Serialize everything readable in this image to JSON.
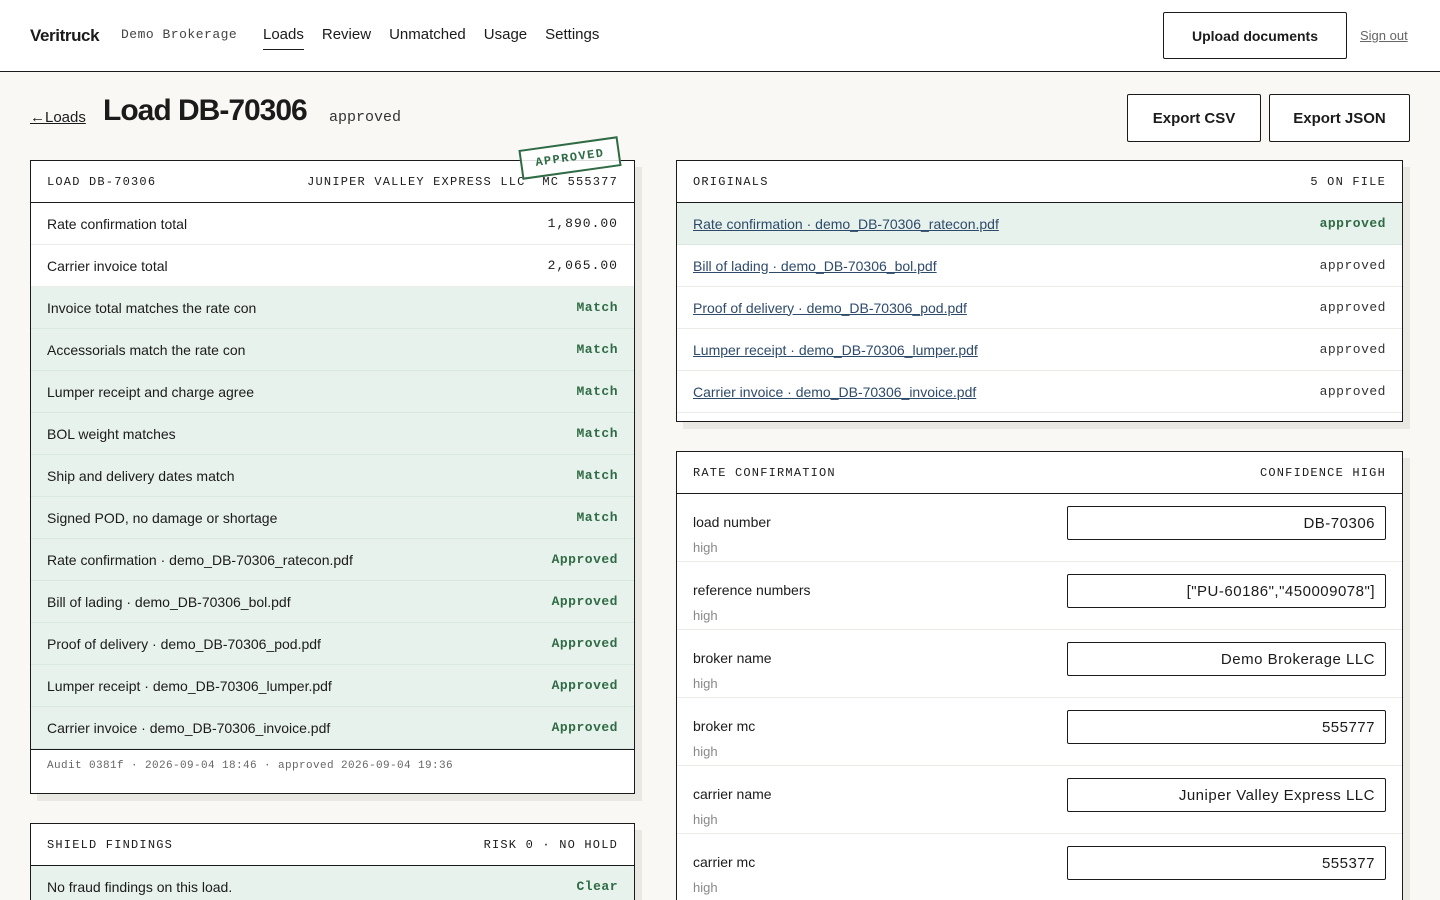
{
  "topbar": {
    "brand": "Veritruck",
    "org": "Demo Brokerage",
    "nav": [
      "Loads",
      "Review",
      "Unmatched",
      "Usage",
      "Settings"
    ],
    "active_nav": "Loads",
    "upload_label": "Upload documents",
    "signout_label": "Sign out"
  },
  "header": {
    "back_label": "←Loads",
    "title": "Load DB-70306",
    "status": "approved",
    "export_csv": "Export CSV",
    "export_json": "Export JSON"
  },
  "load_card": {
    "head_left": "LOAD DB-70306",
    "head_carrier": "JUNIPER VALLEY EXPRESS LLC",
    "head_mc": "MC 555377",
    "stamp": "APPROVED",
    "totals": [
      {
        "label": "Rate confirmation total",
        "value": "1,890.00"
      },
      {
        "label": "Carrier invoice total",
        "value": "2,065.00"
      }
    ],
    "checks": [
      {
        "label": "Invoice total matches the rate con",
        "value": "Match"
      },
      {
        "label": "Accessorials match the rate con",
        "value": "Match"
      },
      {
        "label": "Lumper receipt and charge agree",
        "value": "Match"
      },
      {
        "label": "BOL weight matches",
        "value": "Match"
      },
      {
        "label": "Ship and delivery dates match",
        "value": "Match"
      },
      {
        "label": "Signed POD, no damage or shortage",
        "value": "Match"
      },
      {
        "label": "Rate confirmation · demo_DB-70306_ratecon.pdf",
        "value": "Approved"
      },
      {
        "label": "Bill of lading · demo_DB-70306_bol.pdf",
        "value": "Approved"
      },
      {
        "label": "Proof of delivery · demo_DB-70306_pod.pdf",
        "value": "Approved"
      },
      {
        "label": "Lumper receipt · demo_DB-70306_lumper.pdf",
        "value": "Approved"
      },
      {
        "label": "Carrier invoice · demo_DB-70306_invoice.pdf",
        "value": "Approved"
      }
    ],
    "audit": "Audit 0381f · 2026-09-04 18:46 · approved 2026-09-04 19:36"
  },
  "shield_card": {
    "head_left": "SHIELD FINDINGS",
    "head_right": "RISK 0 · NO HOLD",
    "rows": [
      {
        "label": "No fraud findings on this load.",
        "value": "Clear"
      }
    ]
  },
  "originals_card": {
    "head_left": "ORIGINALS",
    "head_right": "5 ON FILE",
    "docs": [
      {
        "label": "Rate confirmation · demo_DB-70306_ratecon.pdf",
        "status": "approved"
      },
      {
        "label": "Bill of lading · demo_DB-70306_bol.pdf",
        "status": "approved"
      },
      {
        "label": "Proof of delivery · demo_DB-70306_pod.pdf",
        "status": "approved"
      },
      {
        "label": "Lumper receipt · demo_DB-70306_lumper.pdf",
        "status": "approved"
      },
      {
        "label": "Carrier invoice · demo_DB-70306_invoice.pdf",
        "status": "approved"
      }
    ]
  },
  "ratecon_card": {
    "head_left": "RATE CONFIRMATION",
    "head_right": "CONFIDENCE HIGH",
    "fields": [
      {
        "label": "load number",
        "confidence": "high",
        "value": "DB-70306"
      },
      {
        "label": "reference numbers",
        "confidence": "high",
        "value": "[\"PU-60186\",\"450009078\"]"
      },
      {
        "label": "broker name",
        "confidence": "high",
        "value": "Demo Brokerage LLC"
      },
      {
        "label": "broker mc",
        "confidence": "high",
        "value": "555777"
      },
      {
        "label": "carrier name",
        "confidence": "high",
        "value": "Juniper Valley Express LLC"
      },
      {
        "label": "carrier mc",
        "confidence": "high",
        "value": "555377"
      }
    ]
  },
  "colors": {
    "ink": "#1b1b1b",
    "ok_green": "#2f6b45",
    "row_green": "#e8f2ec",
    "link_blue": "#2e4a6b",
    "page_bg": "#f9f8f5"
  }
}
